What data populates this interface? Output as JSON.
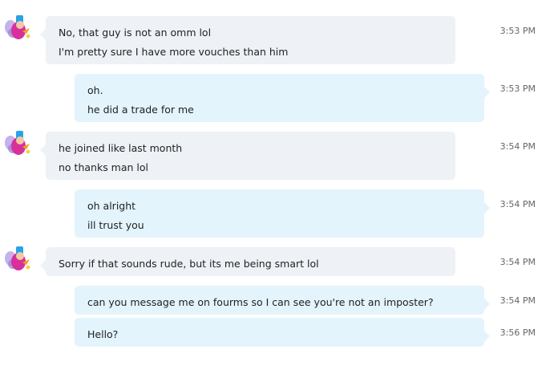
{
  "colors": {
    "incoming_bubble": "#eef1f5",
    "outgoing_bubble": "#e3f4fc",
    "timestamp": "#666666"
  },
  "avatar_icon": "fairy-avatar-icon",
  "messages": [
    {
      "direction": "incoming",
      "lines": [
        "No, that guy is not an omm lol",
        "I'm pretty sure I have more vouches than him"
      ],
      "time": "3:53 PM"
    },
    {
      "direction": "outgoing",
      "lines": [
        "oh.",
        "he did a trade for me"
      ],
      "time": "3:53 PM"
    },
    {
      "direction": "incoming",
      "lines": [
        "he joined like last month",
        "no thanks man lol"
      ],
      "time": "3:54 PM"
    },
    {
      "direction": "outgoing",
      "lines": [
        "oh alright",
        "ill trust you"
      ],
      "time": "3:54 PM"
    },
    {
      "direction": "incoming",
      "lines": [
        "Sorry if that sounds rude, but its me being smart lol"
      ],
      "time": "3:54 PM"
    },
    {
      "direction": "outgoing",
      "lines": [
        "can you message me on fourms so I can see you're not an imposter?"
      ],
      "time": "3:54 PM"
    },
    {
      "direction": "outgoing",
      "lines": [
        "Hello?"
      ],
      "time": "3:56 PM"
    }
  ]
}
